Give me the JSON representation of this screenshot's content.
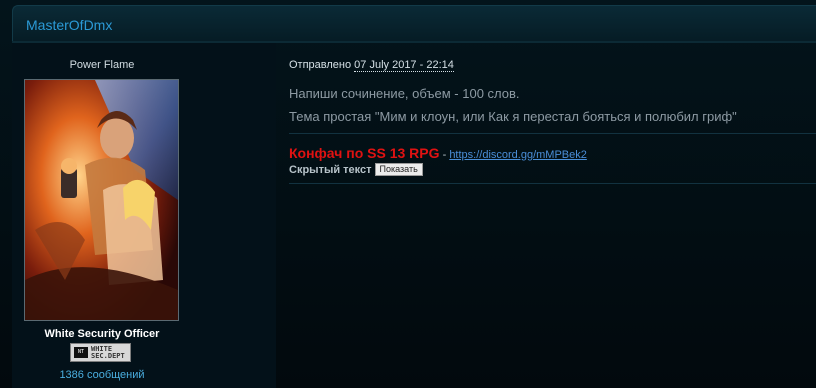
{
  "post": {
    "author": "MasterOfDmx",
    "sent_label": "Отправлено",
    "date": "07 July 2017 - 22:14",
    "lines": [
      "Напиши сочинение, объем - 100 слов.",
      "Тема простая \"Мим и клоун, или Как я перестал бояться и полюбил гриф\""
    ]
  },
  "profile": {
    "rank": "Power Flame",
    "group": "White Security Officer",
    "badge_text": [
      "WHITE",
      "SEC.DEPT"
    ],
    "badge_logo": "NT",
    "post_count": "1386 сообщений"
  },
  "signature": {
    "promo": "Конфач по SS 13 RPG",
    "separator": " - ",
    "link": "https://discord.gg/mMPBek2",
    "spoiler_label": "Скрытый текст",
    "spoiler_button": "Показать"
  },
  "colors": {
    "author": "#2b9ad6",
    "promo": "#e01212",
    "link": "#4a8ed8"
  }
}
